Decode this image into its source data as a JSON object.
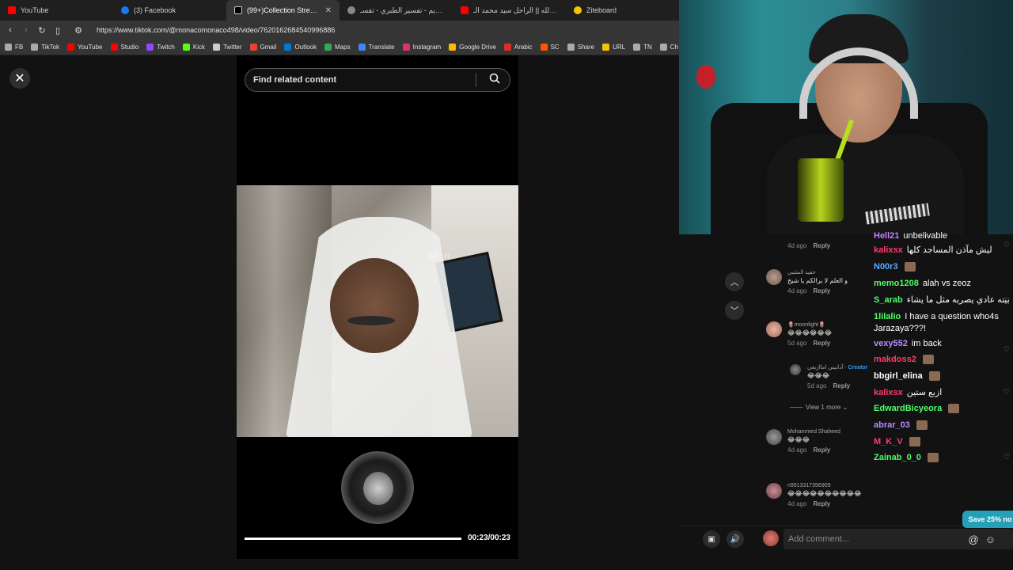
{
  "tabs": [
    {
      "label": "YouTube",
      "color": "#ff0000",
      "active": false
    },
    {
      "label": "(3) Facebook",
      "color": "#1877f2",
      "active": false
    },
    {
      "label": "(99+)Collection Stream cr",
      "color": "#ffffff",
      "active": true
    },
    {
      "label": "القرآن الكريم - تفسير الطبري - تفسـ",
      "color": "#888888",
      "active": false
    },
    {
      "label": "موعود الله || الراحل سيد محمد الـ ||",
      "color": "#ff0000",
      "active": false
    },
    {
      "label": "Ziteboard",
      "color": "#f5c400",
      "active": false
    }
  ],
  "address": {
    "url": "https://www.tiktok.com/@monacomonaco498/video/7620162684540996886"
  },
  "bookmarks": [
    {
      "label": "FB",
      "color": "#aaaaaa"
    },
    {
      "label": "TikTok",
      "color": "#aaaaaa"
    },
    {
      "label": "YouTube",
      "color": "#ff0000"
    },
    {
      "label": "Studio",
      "color": "#ff0000"
    },
    {
      "label": "Twitch",
      "color": "#9146ff"
    },
    {
      "label": "Kick",
      "color": "#53fc18"
    },
    {
      "label": "Twitter",
      "color": "#cccccc"
    },
    {
      "label": "Gmail",
      "color": "#ea4335"
    },
    {
      "label": "Outlook",
      "color": "#0078d4"
    },
    {
      "label": "Maps",
      "color": "#34a853"
    },
    {
      "label": "Translate",
      "color": "#4285f4"
    },
    {
      "label": "Instagram",
      "color": "#e1306c"
    },
    {
      "label": "Google Drive",
      "color": "#fbbc04"
    },
    {
      "label": "Arabic",
      "color": "#d93025"
    },
    {
      "label": "SC",
      "color": "#ff5500"
    },
    {
      "label": "Share",
      "color": "#aaaaaa"
    },
    {
      "label": "URL",
      "color": "#f5c400"
    },
    {
      "label": "TN",
      "color": "#aaaaaa"
    },
    {
      "label": "Ch",
      "color": "#aaaaaa"
    }
  ],
  "player": {
    "search_placeholder": "Find related content",
    "watermark": "Mr_n",
    "time": "00:23/00:23",
    "progress": 1.0
  },
  "tiktok_comments": [
    {
      "name": "",
      "text": "",
      "date": "4d ago",
      "reply": "Reply"
    },
    {
      "name": "حفيد المثنبي",
      "text": "و العلم لا يرالكم يا شيخ",
      "date": "4d ago",
      "reply": "Reply"
    },
    {
      "name": "🌷moonlight🌷",
      "text": "😂😂😂😂😂😂",
      "date": "5d ago",
      "reply": "Reply"
    },
    {
      "name": "آدانيتي اماازيغي",
      "creator": "· Creator",
      "text": "😂😂😂",
      "date": "5d ago",
      "reply": "Reply"
    },
    {
      "name": "Mohammed Shaheed",
      "text": "😂😂😂",
      "date": "4d ago",
      "reply": "Reply"
    },
    {
      "name": "n9913317356909",
      "text": "😂😂😂😂😂😂😂😂😂😂",
      "date": "4d ago",
      "reply": "Reply"
    }
  ],
  "view_more": "View 1 more",
  "chat": [
    {
      "user": "Hell21",
      "msg": "unbelivable",
      "color": "#c77dff"
    },
    {
      "user": "kalixsx",
      "msg": "ليش مآذن المساجد كلها",
      "color": "#ff3b6b"
    },
    {
      "user": "N00r3",
      "msg": "",
      "color": "#5aa9ff"
    },
    {
      "user": "memo1208",
      "msg": "alah vs zeoz",
      "color": "#4cff6a"
    },
    {
      "user": "S_arab",
      "msg": "بيته عادي يصربه مثل ما يشاء",
      "color": "#4cff6a"
    },
    {
      "user": "1lilalio",
      "msg": "I have a question who4s Jarazaya???!",
      "color": "#4cff6a"
    },
    {
      "user": "vexy552",
      "msg": "im back",
      "color": "#b58cff"
    },
    {
      "user": "makdoss2",
      "msg": "",
      "color": "#ff3b6b"
    },
    {
      "user": "bbgirl_elina",
      "msg": "",
      "color": "#ffffff"
    },
    {
      "user": "kalixsx",
      "msg": "ازبع ستين",
      "color": "#ff3b6b"
    },
    {
      "user": "EdwardBicyeora",
      "msg": "",
      "color": "#4cff6a"
    },
    {
      "user": "abrar_03",
      "msg": "",
      "color": "#b58cff"
    },
    {
      "user": "M_K_V",
      "msg": "",
      "color": "#ff3b6b"
    },
    {
      "user": "Zainab_0_0",
      "msg": "",
      "color": "#4cff6a"
    }
  ],
  "add_comment": {
    "placeholder": "Add comment..."
  },
  "promo": "Save 25% no"
}
